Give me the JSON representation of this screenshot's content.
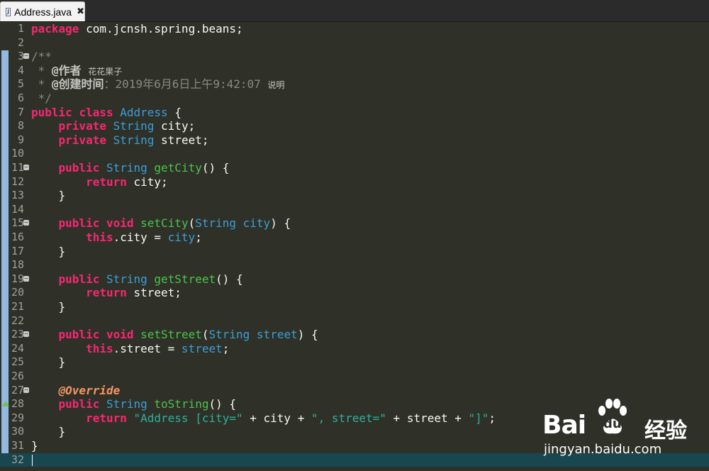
{
  "tab": {
    "title": "Address.java",
    "icon": "java-file-icon",
    "close": "✖"
  },
  "lines": [
    {
      "n": "1",
      "parts": [
        {
          "c": "kw",
          "t": "package"
        },
        {
          "t": " com.jcnsh.spring.beans;"
        }
      ]
    },
    {
      "n": "2",
      "parts": []
    },
    {
      "n": "3",
      "fold": true,
      "parts": [
        {
          "c": "cmt",
          "t": "/**"
        }
      ]
    },
    {
      "n": "4",
      "parts": [
        {
          "c": "cmt",
          "t": " * "
        },
        {
          "c": "tag",
          "t": "@作者"
        },
        {
          "c": "cmt",
          "t": " "
        },
        {
          "c": "cn",
          "t": "花花果子"
        }
      ]
    },
    {
      "n": "5",
      "parts": [
        {
          "c": "cmt",
          "t": " * "
        },
        {
          "c": "tag",
          "t": "@创建时间"
        },
        {
          "c": "cmt",
          "t": "：2019年6月6日上午9:42:07 "
        },
        {
          "c": "cn",
          "t": "说明"
        }
      ]
    },
    {
      "n": "6",
      "parts": [
        {
          "c": "cmt",
          "t": " */"
        }
      ]
    },
    {
      "n": "7",
      "parts": [
        {
          "c": "kw",
          "t": "public"
        },
        {
          "t": " "
        },
        {
          "c": "kw",
          "t": "class"
        },
        {
          "t": " "
        },
        {
          "c": "ty",
          "t": "Address"
        },
        {
          "t": " {"
        }
      ]
    },
    {
      "n": "8",
      "parts": [
        {
          "t": "    "
        },
        {
          "c": "kw",
          "t": "private"
        },
        {
          "t": " "
        },
        {
          "c": "ty",
          "t": "String"
        },
        {
          "t": " city;"
        }
      ]
    },
    {
      "n": "9",
      "parts": [
        {
          "t": "    "
        },
        {
          "c": "kw",
          "t": "private"
        },
        {
          "t": " "
        },
        {
          "c": "ty",
          "t": "String"
        },
        {
          "t": " street;"
        }
      ]
    },
    {
      "n": "10",
      "parts": []
    },
    {
      "n": "11",
      "fold": true,
      "parts": [
        {
          "t": "    "
        },
        {
          "c": "kw",
          "t": "public"
        },
        {
          "t": " "
        },
        {
          "c": "ty",
          "t": "String"
        },
        {
          "t": " "
        },
        {
          "c": "fn",
          "t": "getCity"
        },
        {
          "t": "() {"
        }
      ]
    },
    {
      "n": "12",
      "parts": [
        {
          "t": "        "
        },
        {
          "c": "kw",
          "t": "return"
        },
        {
          "t": " city;"
        }
      ]
    },
    {
      "n": "13",
      "parts": [
        {
          "t": "    }"
        }
      ]
    },
    {
      "n": "14",
      "parts": []
    },
    {
      "n": "15",
      "fold": true,
      "parts": [
        {
          "t": "    "
        },
        {
          "c": "kw",
          "t": "public"
        },
        {
          "t": " "
        },
        {
          "c": "kw",
          "t": "void"
        },
        {
          "t": " "
        },
        {
          "c": "fn",
          "t": "setCity"
        },
        {
          "t": "("
        },
        {
          "c": "ty",
          "t": "String"
        },
        {
          "t": " "
        },
        {
          "c": "ty",
          "t": "city"
        },
        {
          "t": ") {"
        }
      ]
    },
    {
      "n": "16",
      "parts": [
        {
          "t": "        "
        },
        {
          "c": "kw",
          "t": "this"
        },
        {
          "t": ".city = "
        },
        {
          "c": "ty",
          "t": "city"
        },
        {
          "t": ";"
        }
      ]
    },
    {
      "n": "17",
      "parts": [
        {
          "t": "    }"
        }
      ]
    },
    {
      "n": "18",
      "parts": []
    },
    {
      "n": "19",
      "fold": true,
      "parts": [
        {
          "t": "    "
        },
        {
          "c": "kw",
          "t": "public"
        },
        {
          "t": " "
        },
        {
          "c": "ty",
          "t": "String"
        },
        {
          "t": " "
        },
        {
          "c": "fn",
          "t": "getStreet"
        },
        {
          "t": "() {"
        }
      ]
    },
    {
      "n": "20",
      "parts": [
        {
          "t": "        "
        },
        {
          "c": "kw",
          "t": "return"
        },
        {
          "t": " street;"
        }
      ]
    },
    {
      "n": "21",
      "parts": [
        {
          "t": "    }"
        }
      ]
    },
    {
      "n": "22",
      "parts": []
    },
    {
      "n": "23",
      "fold": true,
      "parts": [
        {
          "t": "    "
        },
        {
          "c": "kw",
          "t": "public"
        },
        {
          "t": " "
        },
        {
          "c": "kw",
          "t": "void"
        },
        {
          "t": " "
        },
        {
          "c": "fn",
          "t": "setStreet"
        },
        {
          "t": "("
        },
        {
          "c": "ty",
          "t": "String"
        },
        {
          "t": " "
        },
        {
          "c": "ty",
          "t": "street"
        },
        {
          "t": ") {"
        }
      ]
    },
    {
      "n": "24",
      "parts": [
        {
          "t": "        "
        },
        {
          "c": "kw",
          "t": "this"
        },
        {
          "t": ".street = "
        },
        {
          "c": "ty",
          "t": "street"
        },
        {
          "t": ";"
        }
      ]
    },
    {
      "n": "25",
      "parts": [
        {
          "t": "    }"
        }
      ]
    },
    {
      "n": "26",
      "parts": []
    },
    {
      "n": "27",
      "fold": true,
      "parts": [
        {
          "t": "    "
        },
        {
          "c": "ann",
          "t": "@Override"
        }
      ]
    },
    {
      "n": "28",
      "override": true,
      "parts": [
        {
          "t": "    "
        },
        {
          "c": "kw",
          "t": "public"
        },
        {
          "t": " "
        },
        {
          "c": "ty",
          "t": "String"
        },
        {
          "t": " "
        },
        {
          "c": "fn",
          "t": "toString"
        },
        {
          "t": "() {"
        }
      ]
    },
    {
      "n": "29",
      "parts": [
        {
          "t": "        "
        },
        {
          "c": "kw",
          "t": "return"
        },
        {
          "t": " "
        },
        {
          "c": "str",
          "t": "\"Address [city=\""
        },
        {
          "t": " + city + "
        },
        {
          "c": "str",
          "t": "\", street=\""
        },
        {
          "t": " + street + "
        },
        {
          "c": "str",
          "t": "\"]\""
        },
        {
          "t": ";"
        }
      ]
    },
    {
      "n": "30",
      "parts": [
        {
          "t": "    }"
        }
      ]
    },
    {
      "n": "31",
      "parts": [
        {
          "t": "}"
        }
      ]
    },
    {
      "n": "32",
      "current": true,
      "parts": []
    }
  ],
  "watermark": {
    "brand_bai": "Bai",
    "brand_du": "du",
    "brand_cn": "经验",
    "url": "jingyan.baidu.com"
  },
  "colors": {
    "background": "#2f3129",
    "keyword": "#f92672",
    "type": "#3a9fd6",
    "method": "#4cc24c",
    "string": "#2eb09a",
    "annotation": "#f49562",
    "current_line": "#18474f"
  }
}
